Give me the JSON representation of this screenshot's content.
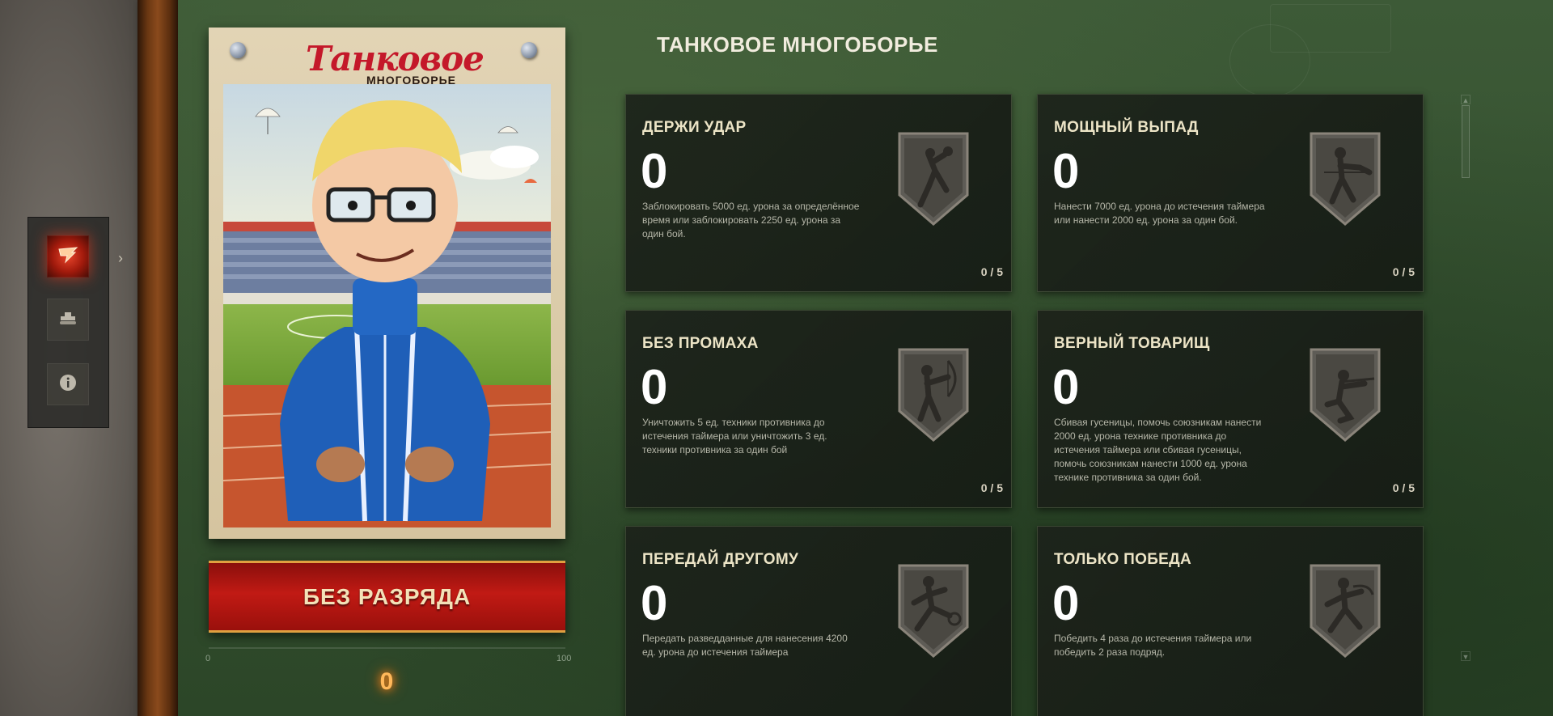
{
  "header": {
    "title": "ТАНКОВОЕ МНОГОБОРЬЕ"
  },
  "nav": {
    "items": [
      {
        "icon": "event-emblem-icon",
        "active": true
      },
      {
        "icon": "tank-icon",
        "active": false
      },
      {
        "icon": "info-icon",
        "active": false
      }
    ]
  },
  "poster": {
    "title": "Танковое",
    "subtitle": "МНОГОБОРЬЕ"
  },
  "rank": {
    "label": "БЕЗ РАЗРЯДА",
    "progress_min": "0",
    "progress_max": "100",
    "progress_value": "0"
  },
  "cards": [
    {
      "title": "ДЕРЖИ УДАР",
      "count": "0",
      "desc": "Заблокировать 5000 ед. урона за определённое время или заблокировать 2250 ед. урона за один бой.",
      "progress": "0 / 5",
      "badge": "volleyball-player-badge-icon"
    },
    {
      "title": "МОЩНЫЙ ВЫПАД",
      "count": "0",
      "desc": "Нанести 7000 ед. урона до истечения таймера или нанести 2000 ед. урона за один бой.",
      "progress": "0 / 5",
      "badge": "fencer-badge-icon"
    },
    {
      "title": "БЕЗ ПРОМАХА",
      "count": "0",
      "desc": "Уничтожить 5 ед. техники противника до истечения таймера или уничтожить 3 ед. техники противника за один бой",
      "progress": "0 / 5",
      "badge": "archer-badge-icon"
    },
    {
      "title": "ВЕРНЫЙ ТОВАРИЩ",
      "count": "0",
      "desc": "Сбивая гусеницы, помочь союзникам нанести 2000 ед. урона технике противника до истечения таймера или сбивая гусеницы, помочь союзникам нанести 1000 ед. урона технике противника за один бой.",
      "progress": "0 / 5",
      "badge": "shooter-badge-icon"
    },
    {
      "title": "ПЕРЕДАЙ ДРУГОМУ",
      "count": "0",
      "desc": "Передать разведданные для нанесения 4200 ед. урона до истечения таймера",
      "progress": "",
      "badge": "football-player-badge-icon"
    },
    {
      "title": "ТОЛЬКО ПОБЕДА",
      "count": "0",
      "desc": "Победить 4 раза до истечения таймера или победить 2 раза подряд.",
      "progress": "",
      "badge": "runner-badge-icon"
    }
  ]
}
